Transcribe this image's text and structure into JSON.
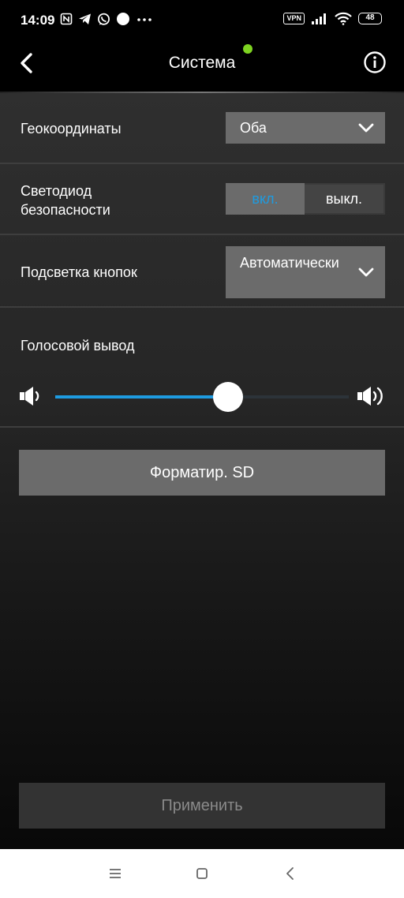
{
  "status_bar": {
    "time": "14:09",
    "vpn": "VPN",
    "battery": "48",
    "left_icons": [
      "nfc-icon",
      "telegram-icon",
      "whatsapp-icon",
      "circle-icon",
      "more-dots-icon"
    ],
    "right_icons": [
      "vpn-badge",
      "signal-icon",
      "wifi-icon",
      "battery-icon"
    ]
  },
  "header": {
    "title": "Система",
    "back_icon": "chevron-left-icon",
    "info_icon": "info-icon",
    "status_dot_color": "#7ed321"
  },
  "settings": {
    "geocoords": {
      "label": "Геокоординаты",
      "value": "Оба"
    },
    "security_led": {
      "label": "Светодиод безопасности",
      "on_label": "вкл.",
      "off_label": "выкл.",
      "selected": "on"
    },
    "button_backlight": {
      "label": "Подсветка кнопок",
      "value": "Автоматически"
    },
    "voice_output": {
      "label": "Голосовой вывод",
      "level": 0.59
    }
  },
  "buttons": {
    "format_sd": "Форматир. SD",
    "apply": "Применить"
  },
  "nav_bar": {
    "icons": [
      "menu-icon",
      "home-square-icon",
      "back-triangle-icon"
    ]
  },
  "colors": {
    "accent": "#1e9be0",
    "control_bg": "#6b6b6b",
    "online": "#7ed321"
  }
}
